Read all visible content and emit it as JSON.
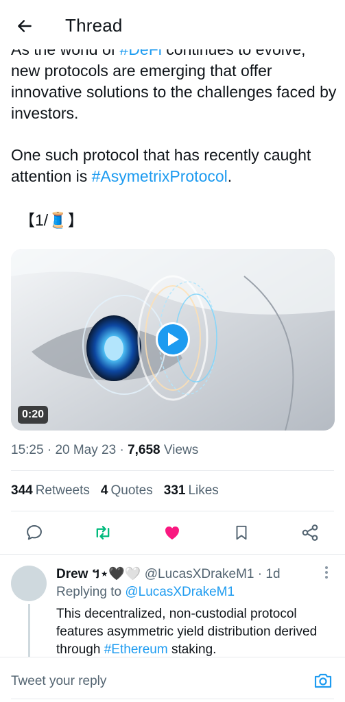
{
  "header": {
    "title": "Thread",
    "back_icon": "arrow-left-icon"
  },
  "tweet": {
    "para1_prefix": "As the world of ",
    "para1_tag": "#DeFi",
    "para1_suffix": " continues to evolve, new protocols are emerging that offer innovative solutions to the challenges faced by investors.",
    "para2_prefix": "One such protocol that has recently caught attention is ",
    "para2_tag": "#AsymetrixProtocol",
    "para2_suffix": ".",
    "para3": "【1/🧵】",
    "video_duration": "0:20",
    "time": "15:25",
    "date": "20 May 23",
    "views_count": "7,658",
    "views_label": "Views"
  },
  "stats": {
    "retweets_count": "344",
    "retweets_label": "Retweets",
    "quotes_count": "4",
    "quotes_label": "Quotes",
    "likes_count": "331",
    "likes_label": "Likes"
  },
  "actions": {
    "reply_icon": "comment-icon",
    "retweet_icon": "retweet-icon",
    "like_icon": "heart-icon",
    "bookmark_icon": "bookmark-icon",
    "share_icon": "share-icon",
    "retweet_color": "#00ba7c",
    "like_color": "#f91880"
  },
  "reply": {
    "name": "Drew",
    "name_emoji": "។⋆🖤🤍",
    "handle": "@LucasXDrakeM1",
    "time": "1d",
    "replying_prefix": "Replying to",
    "replying_mention": "@LucasXDrakeM1",
    "body_prefix": "This decentralized, non-custodial protocol features asymmetric yield distribution derived through ",
    "body_tag": "#Ethereum",
    "body_suffix": " staking."
  },
  "compose": {
    "placeholder": "Tweet your reply",
    "camera_icon": "camera-icon"
  },
  "colors": {
    "accent": "#1d9bf0",
    "text": "#0f1419",
    "muted": "#536471"
  }
}
